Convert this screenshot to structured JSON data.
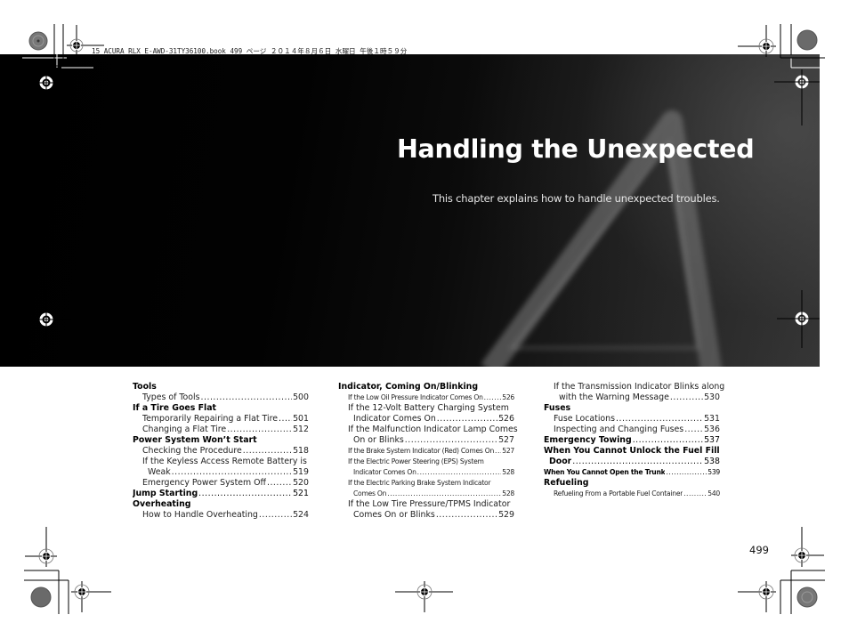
{
  "print_header": "15 ACURA RLX E-AWD-31TY36100.book  499 ページ  ２０１４年８月６日  水曜日  午後１時５９分",
  "chapter": {
    "title": "Handling the Unexpected",
    "subtitle": "This chapter explains how to handle unexpected troubles."
  },
  "toc": {
    "col1": [
      {
        "label": "Tools",
        "page": "",
        "type": "head"
      },
      {
        "label": "Types of Tools",
        "page": "500",
        "type": "sub"
      },
      {
        "label": "If a Tire Goes Flat",
        "page": "",
        "type": "head"
      },
      {
        "label": "Temporarily Repairing a Flat Tire",
        "page": "501",
        "type": "sub"
      },
      {
        "label": "Changing a Flat Tire",
        "page": "512",
        "type": "sub"
      },
      {
        "label": "Power System Won’t Start",
        "page": "",
        "type": "head"
      },
      {
        "label": "Checking the Procedure",
        "page": "518",
        "type": "sub"
      },
      {
        "label": "If the Keyless Access Remote Battery is",
        "label2": "Weak",
        "page": "519",
        "type": "sub"
      },
      {
        "label": "Emergency Power System Off",
        "page": "520",
        "type": "sub"
      },
      {
        "label": "Jump Starting",
        "page": "521",
        "type": "head"
      },
      {
        "label": "Overheating",
        "page": "",
        "type": "head"
      },
      {
        "label": "How to Handle Overheating",
        "page": "524",
        "type": "sub"
      }
    ],
    "col2": [
      {
        "label": "Indicator, Coming On/Blinking",
        "page": "",
        "type": "head"
      },
      {
        "label": "If the Low Oil Pressure Indicator Comes On",
        "page": "526",
        "type": "sub-small"
      },
      {
        "label": "If the 12-Volt Battery Charging System",
        "label2": "Indicator Comes On",
        "page": "526",
        "type": "sub"
      },
      {
        "label": "If the Malfunction Indicator Lamp Comes",
        "label2": "On or Blinks",
        "page": "527",
        "type": "sub"
      },
      {
        "label": "If the Brake System Indicator (Red) Comes On",
        "page": "527",
        "type": "sub-small"
      },
      {
        "label": "If the Electric Power Steering (EPS) System",
        "label2": "Indicator Comes On",
        "page": "528",
        "type": "sub-small"
      },
      {
        "label": "If the Electric Parking Brake System Indicator",
        "label2": "Comes On",
        "page": "528",
        "type": "sub-small"
      },
      {
        "label": "If the Low Tire Pressure/TPMS Indicator",
        "label2": "Comes On or Blinks",
        "page": "529",
        "type": "sub"
      }
    ],
    "col3": [
      {
        "label": "If the Transmission Indicator Blinks along",
        "label2": "with the Warning Message",
        "page": "530",
        "type": "sub"
      },
      {
        "label": "Fuses",
        "page": "",
        "type": "head"
      },
      {
        "label": "Fuse Locations",
        "page": "531",
        "type": "sub"
      },
      {
        "label": "Inspecting and Changing Fuses",
        "page": "536",
        "type": "sub"
      },
      {
        "label": "Emergency Towing",
        "page": "537",
        "type": "head"
      },
      {
        "label": "When You Cannot Unlock the Fuel Fill",
        "label2": "Door",
        "page": "538",
        "type": "head"
      },
      {
        "label": "When You Cannot Open the Trunk",
        "page": "539",
        "type": "head-small"
      },
      {
        "label": "Refueling",
        "page": "",
        "type": "head"
      },
      {
        "label": "Refueling From a Portable Fuel Container",
        "page": "540",
        "type": "sub-small"
      }
    ]
  },
  "page_number": "499",
  "colors": {
    "banner": "#000000",
    "title": "#ffffff",
    "text": "#111111"
  }
}
